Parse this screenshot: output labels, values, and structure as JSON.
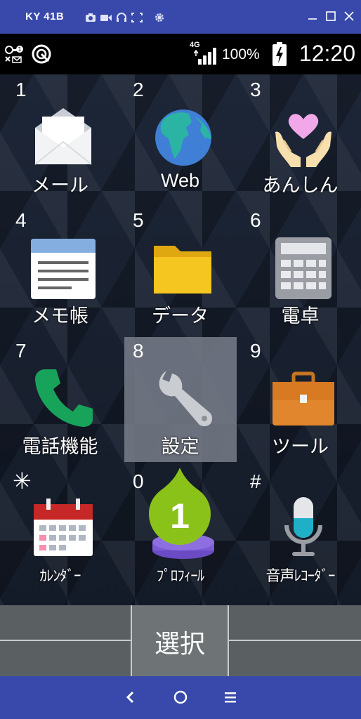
{
  "window": {
    "title": "KY 41B"
  },
  "status": {
    "network": "4G",
    "battery": "100%",
    "time": "12:20"
  },
  "apps": [
    {
      "key": "1",
      "label": "メール",
      "icon": "mail-icon"
    },
    {
      "key": "2",
      "label": "Web",
      "icon": "globe-icon"
    },
    {
      "key": "3",
      "label": "あんしん",
      "icon": "heart-hands-icon"
    },
    {
      "key": "4",
      "label": "メモ帳",
      "icon": "notepad-icon"
    },
    {
      "key": "5",
      "label": "データ",
      "icon": "folder-icon"
    },
    {
      "key": "6",
      "label": "電卓",
      "icon": "calculator-icon"
    },
    {
      "key": "7",
      "label": "電話機能",
      "icon": "phone-icon"
    },
    {
      "key": "8",
      "label": "設定",
      "icon": "wrench-icon"
    },
    {
      "key": "9",
      "label": "ツール",
      "icon": "briefcase-icon"
    },
    {
      "key": "✳",
      "label": "ｶﾚﾝﾀﾞｰ",
      "icon": "calendar-icon"
    },
    {
      "key": "0",
      "label": "ﾌﾟﾛﾌｨｰﾙ",
      "icon": "profile-icon"
    },
    {
      "key": "#",
      "label": "音声ﾚｺｰﾀﾞｰ",
      "icon": "microphone-icon"
    }
  ],
  "badge": {
    "text": "1"
  },
  "softkey": {
    "center": "選択"
  }
}
